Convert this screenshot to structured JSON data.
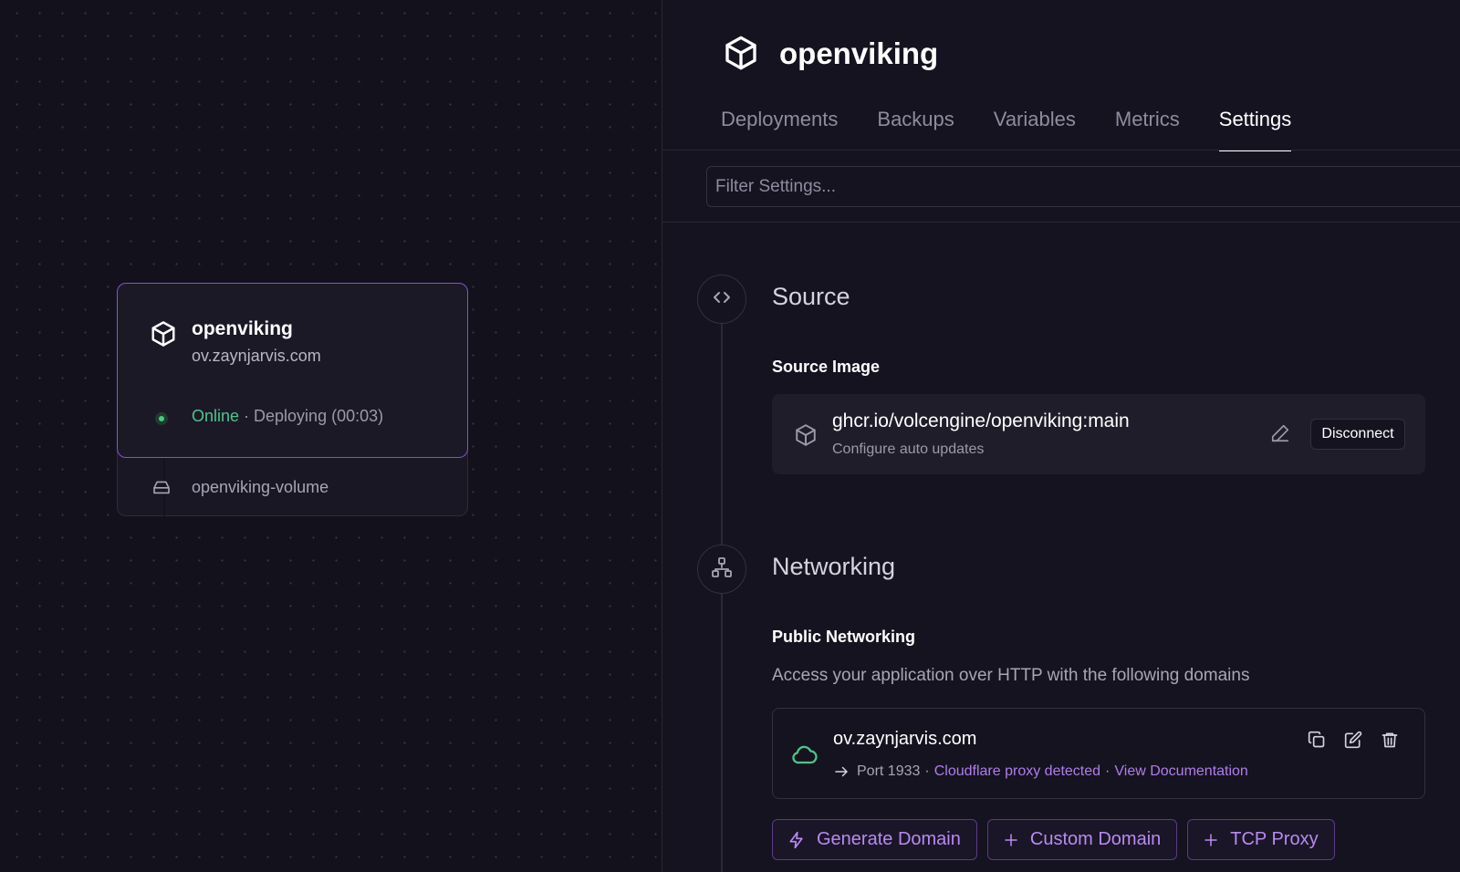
{
  "service_card": {
    "name": "openviking",
    "domain": "ov.zaynjarvis.com",
    "status_online": "Online",
    "status_rest": " · Deploying (00:03)",
    "volume_name": "openviking-volume"
  },
  "header": {
    "title": "openviking"
  },
  "tabs": [
    {
      "label": "Deployments"
    },
    {
      "label": "Backups"
    },
    {
      "label": "Variables"
    },
    {
      "label": "Metrics"
    },
    {
      "label": "Settings",
      "active": true
    }
  ],
  "filter": {
    "placeholder": "Filter Settings..."
  },
  "source": {
    "title": "Source",
    "subtitle": "Source Image",
    "image_name": "ghcr.io/volcengine/openviking:main",
    "image_sub": "Configure auto updates",
    "disconnect_label": "Disconnect"
  },
  "networking": {
    "title": "Networking",
    "subtitle": "Public Networking",
    "description": "Access your application over HTTP with the following domains",
    "domain": "ov.zaynjarvis.com",
    "port_text": "Port 1933",
    "proxy_link": "Cloudflare proxy detected",
    "docs_link": "View Documentation",
    "buttons": {
      "generate": "Generate Domain",
      "custom": "Custom Domain",
      "tcp": "TCP Proxy"
    }
  },
  "colors": {
    "accent": "#8a4fd1",
    "online": "#4ec48a",
    "link": "#b07cf0",
    "background": "#13111c"
  },
  "icons": {
    "service": "cube-icon",
    "volume": "hard-drive-icon",
    "source": "code-icon",
    "networking": "network-icon",
    "domain": "cloud-icon"
  }
}
